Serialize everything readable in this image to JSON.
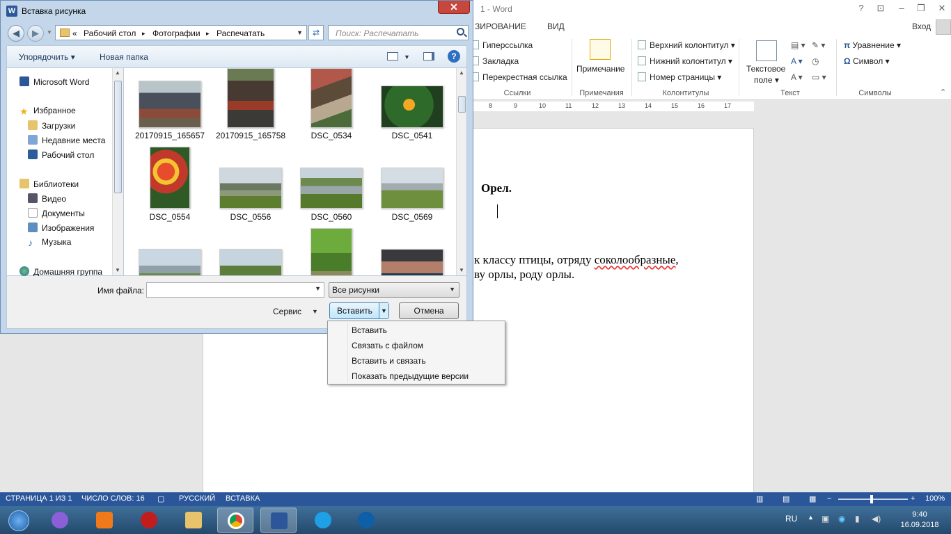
{
  "word": {
    "title": "1 - Word",
    "tabs": [
      "ЗИРОВАНИЕ",
      "ВИД"
    ],
    "signin": "Вход",
    "ribbon": {
      "links_items": [
        "Гиперссылка",
        "Закладка",
        "Перекрестная ссылка"
      ],
      "links_group": "Ссылки",
      "note_label": "Примечание",
      "note_group": "Примечания",
      "hf_items": [
        "Верхний колонтитул",
        "Нижний колонтитул",
        "Номер страницы"
      ],
      "hf_group": "Колонтитулы",
      "textbox_label_1": "Текстовое",
      "textbox_label_2": "поле",
      "text_group": "Текст",
      "symbol_items": [
        "Уравнение",
        "Символ"
      ],
      "symbols_group": "Символы"
    },
    "ruler_numbers": [
      "8",
      "9",
      "10",
      "11",
      "12",
      "13",
      "14",
      "15",
      "16",
      "17"
    ],
    "doc": {
      "heading": "Орел.",
      "line1_pre": "к классу птицы, отряду ",
      "line1_err": "соколообразные",
      "line1_post": ",",
      "line2": "ву орлы, роду орлы."
    },
    "status": {
      "page": "СТРАНИЦА 1 ИЗ 1",
      "words": "ЧИСЛО СЛОВ: 16",
      "lang": "РУССКИЙ",
      "mode": "ВСТАВКА",
      "zoom": "100%",
      "zoom_level": 1.0
    }
  },
  "dialog": {
    "title": "Вставка рисунка",
    "close": "✕",
    "breadcrumb": [
      "«",
      "Рабочий стол",
      "▸",
      "Фотографии",
      "▸",
      "Распечатать"
    ],
    "search_placeholder": "Поиск: Распечатать",
    "toolbar": {
      "organize": "Упорядочить ▾",
      "new_folder": "Новая папка",
      "help": "?"
    },
    "nav": {
      "word": "Microsoft Word",
      "favorites": "Избранное",
      "downloads": "Загрузки",
      "recent": "Недавние места",
      "desktop": "Рабочий стол",
      "libraries": "Библиотеки",
      "video": "Видео",
      "docs": "Документы",
      "images": "Изображения",
      "music": "Музыка",
      "homegroup": "Домашняя группа"
    },
    "files": [
      "20170915_165657",
      "20170915_165758",
      "DSC_0534",
      "DSC_0541",
      "DSC_0554",
      "DSC_0556",
      "DSC_0560",
      "DSC_0569"
    ],
    "file_name_label": "Имя файла:",
    "file_name_value": "",
    "filter": "Все рисунки",
    "service": "Сервис",
    "insert": "Вставить",
    "cancel": "Отмена"
  },
  "insert_menu": [
    "Вставить",
    "Связать с файлом",
    "Вставить и связать",
    "Показать предыдущие версии"
  ],
  "taskbar": {
    "lang": "RU",
    "time": "9:40",
    "date": "16.09.2018"
  },
  "colors": {
    "word_blue": "#2b579a",
    "dialog_frame": "#c3d6ea",
    "error_red": "#e33333"
  }
}
